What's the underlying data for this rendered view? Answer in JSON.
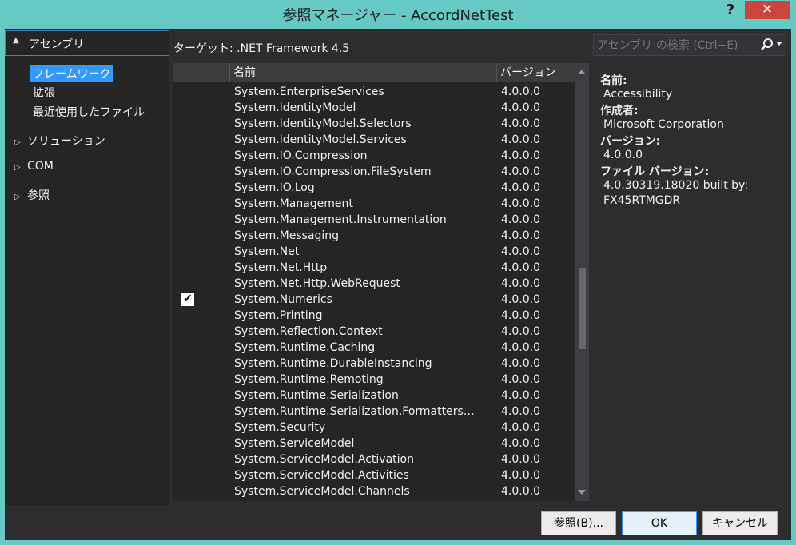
{
  "window": {
    "title": "参照マネージャー - AccordNetTest",
    "help": "?",
    "close": "✕"
  },
  "nav": {
    "header": "アセンブリ",
    "subitems": [
      "フレームワーク",
      "拡張",
      "最近使用したファイル"
    ],
    "categories": [
      "ソリューション",
      "COM",
      "参照"
    ]
  },
  "target": "ターゲット: .NET Framework 4.5",
  "search": {
    "placeholder": "アセンブリ の検索 (Ctrl+E)"
  },
  "list": {
    "col_name": "名前",
    "col_version": "バージョン",
    "rows": [
      {
        "name": "System.EnterpriseServices",
        "version": "4.0.0.0",
        "checked": false
      },
      {
        "name": "System.IdentityModel",
        "version": "4.0.0.0",
        "checked": false
      },
      {
        "name": "System.IdentityModel.Selectors",
        "version": "4.0.0.0",
        "checked": false
      },
      {
        "name": "System.IdentityModel.Services",
        "version": "4.0.0.0",
        "checked": false
      },
      {
        "name": "System.IO.Compression",
        "version": "4.0.0.0",
        "checked": false
      },
      {
        "name": "System.IO.Compression.FileSystem",
        "version": "4.0.0.0",
        "checked": false
      },
      {
        "name": "System.IO.Log",
        "version": "4.0.0.0",
        "checked": false
      },
      {
        "name": "System.Management",
        "version": "4.0.0.0",
        "checked": false
      },
      {
        "name": "System.Management.Instrumentation",
        "version": "4.0.0.0",
        "checked": false
      },
      {
        "name": "System.Messaging",
        "version": "4.0.0.0",
        "checked": false
      },
      {
        "name": "System.Net",
        "version": "4.0.0.0",
        "checked": false
      },
      {
        "name": "System.Net.Http",
        "version": "4.0.0.0",
        "checked": false
      },
      {
        "name": "System.Net.Http.WebRequest",
        "version": "4.0.0.0",
        "checked": false
      },
      {
        "name": "System.Numerics",
        "version": "4.0.0.0",
        "checked": true
      },
      {
        "name": "System.Printing",
        "version": "4.0.0.0",
        "checked": false
      },
      {
        "name": "System.Reflection.Context",
        "version": "4.0.0.0",
        "checked": false
      },
      {
        "name": "System.Runtime.Caching",
        "version": "4.0.0.0",
        "checked": false
      },
      {
        "name": "System.Runtime.DurableInstancing",
        "version": "4.0.0.0",
        "checked": false
      },
      {
        "name": "System.Runtime.Remoting",
        "version": "4.0.0.0",
        "checked": false
      },
      {
        "name": "System.Runtime.Serialization",
        "version": "4.0.0.0",
        "checked": false
      },
      {
        "name": "System.Runtime.Serialization.Formatters…",
        "version": "4.0.0.0",
        "checked": false
      },
      {
        "name": "System.Security",
        "version": "4.0.0.0",
        "checked": false
      },
      {
        "name": "System.ServiceModel",
        "version": "4.0.0.0",
        "checked": false
      },
      {
        "name": "System.ServiceModel.Activation",
        "version": "4.0.0.0",
        "checked": false
      },
      {
        "name": "System.ServiceModel.Activities",
        "version": "4.0.0.0",
        "checked": false
      },
      {
        "name": "System.ServiceModel.Channels",
        "version": "4.0.0.0",
        "checked": false
      }
    ]
  },
  "detail": {
    "name_label": "名前:",
    "name_value": "Accessibility",
    "author_label": "作成者:",
    "author_value": "Microsoft Corporation",
    "version_label": "バージョン:",
    "version_value": "4.0.0.0",
    "file_version_label": "ファイル バージョン:",
    "file_version_value": "4.0.30319.18020 built by: FX45RTMGDR"
  },
  "buttons": {
    "browse": "参照(B)...",
    "ok": "OK",
    "cancel": "キャンセル"
  },
  "colors": {
    "accent": "#3399ff",
    "chrome": "#67c9c4",
    "close": "#c9463d",
    "panel": "#252526",
    "body": "#2d2d30"
  },
  "icons": {
    "search": "search-icon",
    "expand": "triangle-icon",
    "check": "checkmark-icon"
  }
}
